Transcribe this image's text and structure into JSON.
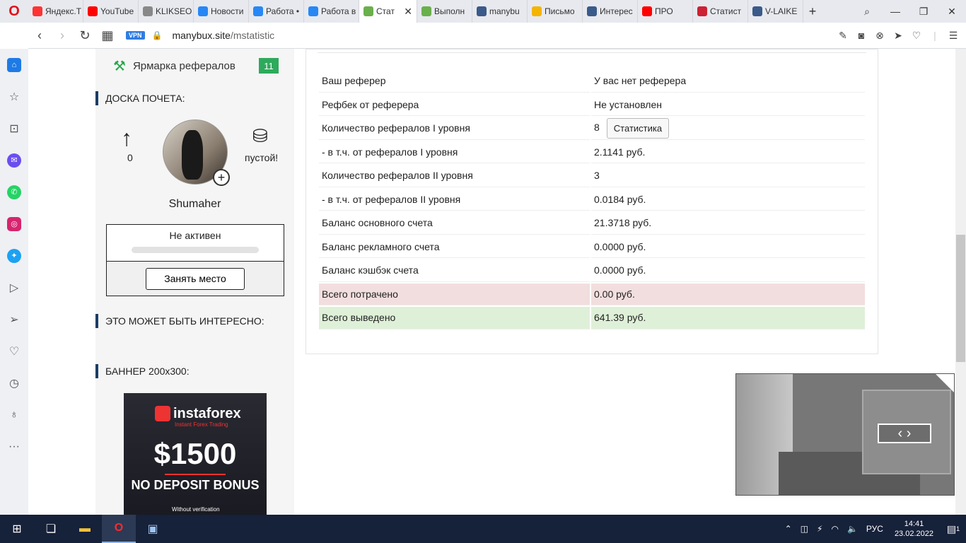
{
  "browser": {
    "tabs": [
      {
        "label": "Яндекс.Т",
        "color": "#f33"
      },
      {
        "label": "YouTube",
        "color": "#f00"
      },
      {
        "label": "KLIKSEO",
        "color": "#888"
      },
      {
        "label": "Новости",
        "color": "#2787f5"
      },
      {
        "label": "Работа •",
        "color": "#2787f5"
      },
      {
        "label": "Работа в",
        "color": "#2787f5"
      },
      {
        "label": "Стат",
        "color": "#6ab04c",
        "active": true
      },
      {
        "label": "Выполн",
        "color": "#6ab04c"
      },
      {
        "label": "manybu",
        "color": "#3a5a8a"
      },
      {
        "label": "Письмо",
        "color": "#f4b400"
      },
      {
        "label": "Интерес",
        "color": "#3a5a8a"
      },
      {
        "label": "ПРО",
        "color": "#f00"
      },
      {
        "label": "Статист",
        "color": "#c23"
      },
      {
        "label": "V-LAIKE",
        "color": "#3a5a8a"
      }
    ],
    "vpn_label": "VPN",
    "url_host": "manybux.site",
    "url_path": "/mstatistic"
  },
  "left": {
    "ref_fair_label": "Ярмарка рефералов",
    "ref_fair_count": "11",
    "honor_heading": "ДОСКА ПОЧЕТА:",
    "honor_count": "0",
    "honor_empty": "пустой!",
    "username": "Shumaher",
    "place_status": "Не активен",
    "take_place_button": "Занять место",
    "interesting_heading": "ЭТО МОЖЕТ БЫТЬ ИНТЕРЕСНО:",
    "banner_heading": "БАННЕР 200x300:",
    "banner": {
      "brand": "instaforex",
      "sub": "Instant Forex Trading",
      "amount": "$1500",
      "bonus": "NO DEPOSIT BONUS",
      "verify": "Without verification"
    }
  },
  "stats": {
    "button_label": "Статистика",
    "rows": [
      {
        "k": "Ваш реферер",
        "v": "У вас нет реферера"
      },
      {
        "k": "Рефбек от реферера",
        "v": "Не установлен"
      },
      {
        "k": "Количество рефералов I уровня",
        "v": "8",
        "button": true
      },
      {
        "k": "- в т.ч. от рефералов I уровня",
        "v": "2.1141 руб."
      },
      {
        "k": "Количество рефералов II уровня",
        "v": "3"
      },
      {
        "k": "- в т.ч. от рефералов II уровня",
        "v": "0.0184 руб."
      },
      {
        "k": "Баланс основного счета",
        "v": "21.3718 руб."
      },
      {
        "k": "Баланс рекламного счета",
        "v": "0.0000 руб."
      },
      {
        "k": "Баланс кэшбэк счета",
        "v": "0.0000 руб."
      },
      {
        "k": "Всего потрачено",
        "v": "0.00 руб.",
        "style": "red"
      },
      {
        "k": "Всего выведено",
        "v": "641.39 руб.",
        "style": "green"
      }
    ]
  },
  "taskbar": {
    "lang": "РУС",
    "time": "14:41",
    "date": "23.02.2022",
    "notifications": "1"
  }
}
